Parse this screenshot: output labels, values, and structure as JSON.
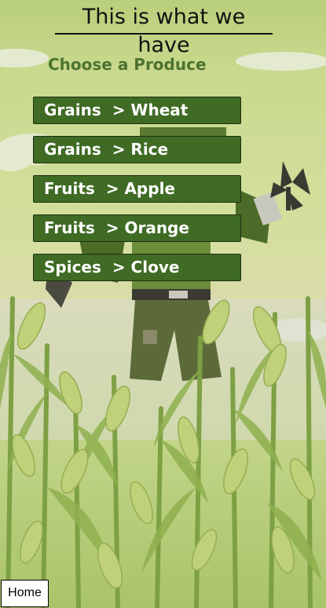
{
  "header": {
    "title": "This is what we have"
  },
  "section": {
    "subtitle": "Choose a Produce"
  },
  "produce_items": [
    {
      "label": "Grains  > Wheat"
    },
    {
      "label": "Grains  > Rice"
    },
    {
      "label": "Fruits  > Apple"
    },
    {
      "label": "Fruits  > Orange"
    },
    {
      "label": "Spices  > Clove"
    }
  ],
  "footer": {
    "home_label": "Home"
  },
  "colors": {
    "button_bg": "#3f6b24",
    "subtitle": "#4d7330"
  },
  "background": {
    "illustration": "scarecrow-in-cornfield-illustration"
  }
}
